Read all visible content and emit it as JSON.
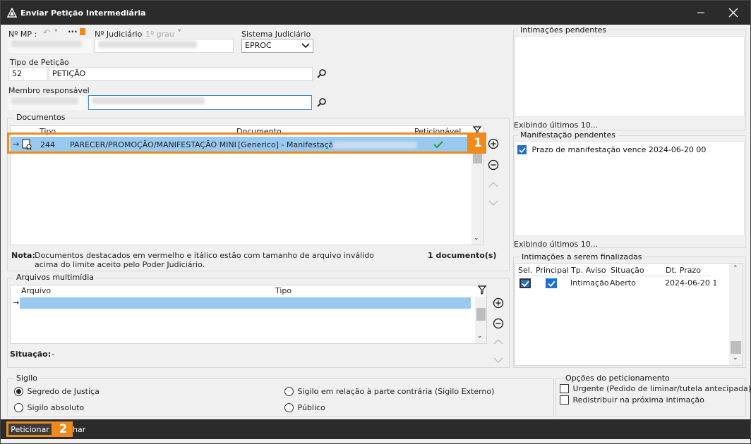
{
  "window": {
    "title": "Enviar Petição Intermediária"
  },
  "header": {
    "mp_label": "Nº MP :",
    "judicial_label": "Nº Judiciário",
    "instance": "1º grau",
    "sistema_label": "Sistema Judiciário",
    "sistema_value": "EPROC"
  },
  "tipo": {
    "label": "Tipo de Petição",
    "code": "52",
    "name": "PETIÇÃO"
  },
  "membro": {
    "label": "Membro responsável"
  },
  "documentos": {
    "label": "Documentos",
    "col_tipo": "Tipo",
    "col_documento": "Documento",
    "col_peticionavel": "Peticionável",
    "rows": [
      {
        "code": "244",
        "tipo": "PARECER/PROMOÇÃO/MANIFESTAÇÃO MINIST",
        "documento": "[Generico] - Manifestação"
      }
    ],
    "note_label": "Nota:",
    "note_line1": "Documentos destacados em vermelho e itálico estão com tamanho de arquivo inválido",
    "note_line2": "acima do limite aceito pelo Poder Judiciário.",
    "count": "1 documento(s)"
  },
  "multimidia": {
    "label": "Arquivos multimídia",
    "col_arquivo": "Arquivo",
    "col_tipo": "Tipo",
    "situacao_label": "Situação:",
    "situacao_value": "-"
  },
  "intimacoes": {
    "label": "Intimações pendentes",
    "footer": "Exibindo últimos 10..."
  },
  "manifestacao": {
    "label": "Manifestação pendentes",
    "item": "Prazo de manifestação vence 2024-06-20 00",
    "footer": "Exibindo últimos 10..."
  },
  "finalizadas": {
    "label": "Intimações a serem finalizadas",
    "cols": [
      "Sel.",
      "Principal",
      "Tp. Aviso",
      "Situação",
      "Dt. Prazo"
    ],
    "row": {
      "aviso": "Intimação",
      "situacao": "Aberto",
      "prazo": "2024-06-20 1"
    }
  },
  "sigilo": {
    "label": "Sigilo",
    "segredo": "Segredo de Justiça",
    "absoluto": "Sigilo absoluto",
    "externo": "Sigilo em relação à parte contrária (Sigilo Externo)",
    "publico": "Público"
  },
  "opcoes": {
    "label": "Opções do peticionamento",
    "urgente": "Urgente (Pedido de liminar/tutela antecipada)",
    "redistribuir": "Redistribuir na próxima intimação"
  },
  "footer": {
    "peticionar": "Peticionar",
    "cancel_partial": "har"
  },
  "callouts": {
    "one": "1",
    "two": "2"
  },
  "colors": {
    "accent": "#f08a1a",
    "selection": "#99c9ef",
    "titlebar": "#2b2b2b",
    "check": "#1f6fd1"
  }
}
